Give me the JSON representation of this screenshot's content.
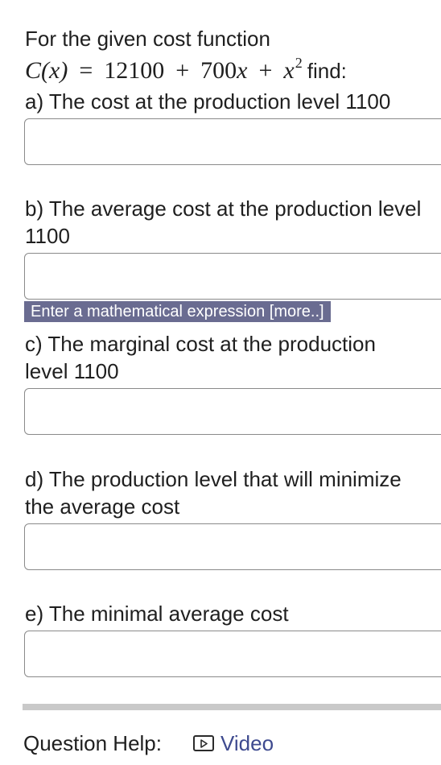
{
  "intro": "For the given cost function",
  "formula": {
    "lhs": "C(x)",
    "equals": "=",
    "const": "12100",
    "plus1": "+",
    "linear_coef": "700",
    "var": "x",
    "plus2": "+",
    "quad_var": "x",
    "exponent": "2",
    "suffix": "find:"
  },
  "parts": {
    "a": {
      "line1": "a) The cost at the production level 1100"
    },
    "b": {
      "line1": "b) The average cost at the production level",
      "line2": "1100"
    },
    "c": {
      "line1": "c) The marginal cost at the production",
      "line2": "level 1100"
    },
    "d": {
      "line1": "d) The production level that will minimize",
      "line2": "the average cost"
    },
    "e": {
      "line1": "e) The minimal average cost"
    }
  },
  "hint": "Enter a mathematical expression [more..]",
  "question_help": {
    "label": "Question Help:",
    "video_label": "Video",
    "icon": "video-play-icon"
  },
  "colors": {
    "hint_bg": "#6a6c91",
    "link": "#3e4a8f",
    "divider": "#c9c9c9"
  }
}
